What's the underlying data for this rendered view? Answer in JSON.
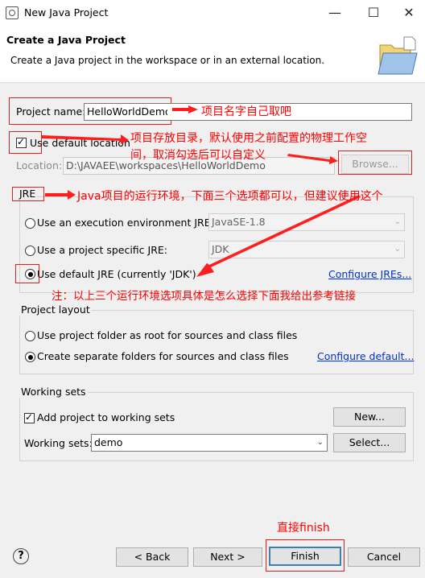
{
  "window": {
    "title": "New Java Project",
    "minimize_icon": "minimize-icon",
    "maximize_icon": "maximize-icon",
    "close_icon": "close-icon"
  },
  "header": {
    "title": "Create a Java Project",
    "subtitle": "Create a Java project in the workspace or in an external location."
  },
  "project": {
    "name_label": "Project name:",
    "name_value": "HelloWorldDemo",
    "use_default_location_label": "Use default location",
    "use_default_location_checked": true,
    "location_label": "Location:",
    "location_value": "D:\\JAVAEE\\workspaces\\HelloWorldDemo",
    "browse_label": "Browse..."
  },
  "jre": {
    "group_label": "JRE",
    "option_env_label": "Use an execution environment JRE:",
    "option_env_value": "JavaSE-1.8",
    "option_specific_label": "Use a project specific JRE:",
    "option_specific_value": "JDK",
    "option_default_label": "Use default JRE (currently 'JDK')",
    "selected": "default",
    "configure_link": "Configure JREs..."
  },
  "layout": {
    "group_label": "Project layout",
    "option_root_label": "Use project folder as root for sources and class files",
    "option_separate_label": "Create separate folders for sources and class files",
    "selected": "separate",
    "configure_link": "Configure default..."
  },
  "working_sets": {
    "group_label": "Working sets",
    "add_label": "Add project to working sets",
    "add_checked": true,
    "new_label": "New...",
    "sets_label": "Working sets:",
    "sets_value": "demo",
    "select_label": "Select..."
  },
  "footer": {
    "help": "?",
    "back": "< Back",
    "next": "Next >",
    "finish": "Finish",
    "cancel": "Cancel"
  },
  "annotations": {
    "project_name": "项目名字自己取吧",
    "location_line1": "项目存放目录，默认使用之前配置的物理工作空",
    "location_line2": "间，取消勾选后可以自定义",
    "jre": "Java项目的运行环境，下面三个选项都可以，但建议使用这个",
    "jre_note": "注：以上三个运行环境选项具体是怎么选择下面我给出参考链接",
    "finish": "直接finish"
  },
  "colors": {
    "annotation": "#ff0000",
    "link": "#0033cc",
    "default_button": "#3c7fb1"
  }
}
